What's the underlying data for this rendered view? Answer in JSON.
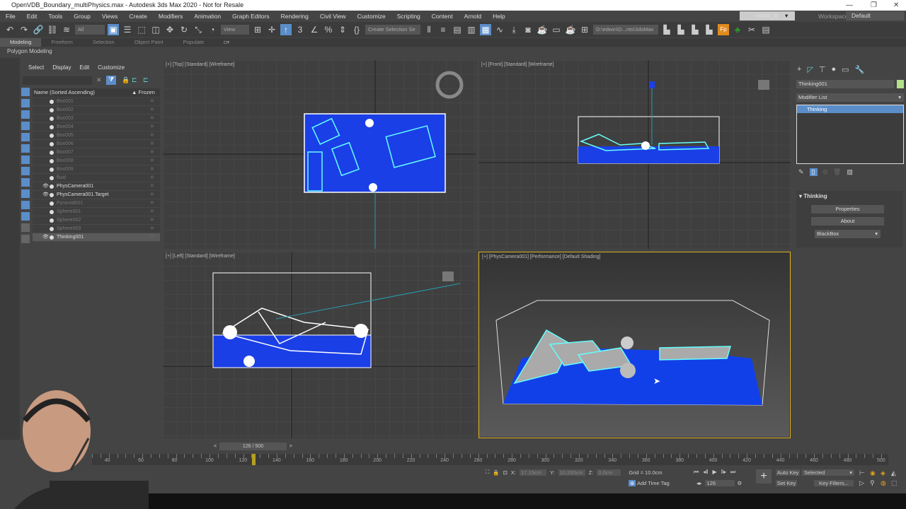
{
  "window": {
    "title": "OpenVDB_Boundary_multiPhysics.max - Autodesk 3ds Max 2020 - Not for Resale"
  },
  "menu": [
    "File",
    "Edit",
    "Tools",
    "Group",
    "Views",
    "Create",
    "Modifiers",
    "Animation",
    "Graph Editors",
    "Rendering",
    "Civil View",
    "Customize",
    "Scripting",
    "Content",
    "Arnold",
    "Help"
  ],
  "user": {
    "name": "edwin_b",
    "workspaces_label": "Workspaces:",
    "workspace": "Default"
  },
  "toolbar": {
    "filter": "All",
    "ref_coord": "View",
    "selection_set": "Create Selection Se",
    "project_path": "D:\\edwin\\D...nts\\3dsMax"
  },
  "ribbon": {
    "tabs": [
      "Modeling",
      "Freeform",
      "Selection",
      "Object Paint",
      "Populate"
    ],
    "active": "Modeling",
    "sub": "Polygon Modeling"
  },
  "explorer": {
    "menu": [
      "Select",
      "Display",
      "Edit",
      "Customize"
    ],
    "col_name": "Name (Sorted Ascending)",
    "col_frozen": "Frozen",
    "rows": [
      {
        "name": "Box001",
        "visible": false
      },
      {
        "name": "Box002",
        "visible": false
      },
      {
        "name": "Box003",
        "visible": false
      },
      {
        "name": "Box004",
        "visible": false
      },
      {
        "name": "Box005",
        "visible": false
      },
      {
        "name": "Box006",
        "visible": false
      },
      {
        "name": "Box007",
        "visible": false
      },
      {
        "name": "Box008",
        "visible": false
      },
      {
        "name": "Box009",
        "visible": false
      },
      {
        "name": "fluid",
        "visible": false
      },
      {
        "name": "PhysCamera001",
        "visible": true
      },
      {
        "name": "PhysCamera001.Target",
        "visible": true
      },
      {
        "name": "Pyramid001",
        "visible": false
      },
      {
        "name": "Sphere001",
        "visible": false
      },
      {
        "name": "Sphere002",
        "visible": false
      },
      {
        "name": "Sphere003",
        "visible": false
      },
      {
        "name": "Thinking001",
        "visible": true,
        "selected": true
      }
    ]
  },
  "viewports": {
    "top": "[+] [Top] [Standard] [Wireframe]",
    "front": "[+] [Front] [Standard] [Wireframe]",
    "left": "[+] [Left] [Standard] [Wireframe]",
    "camera": "[+] [PhysCamera001] [Performance] [Default Shading]"
  },
  "command_panel": {
    "object_name": "Thinking001",
    "object_color": "#b5e08a",
    "modifier_list": "Modifier List",
    "stack": [
      "Thinking"
    ],
    "rollout_title": "Thinking",
    "properties": "Properties",
    "about": "About",
    "blackbox": "BlackBox"
  },
  "timeline": {
    "frame_label": "126 / 500",
    "current_frame": 126,
    "total_frames": 500,
    "ticks": [
      40,
      60,
      80,
      100,
      120,
      140,
      160,
      180,
      200,
      220,
      240,
      260,
      280,
      300,
      320,
      340,
      360,
      380,
      400,
      420,
      440,
      460,
      480,
      500
    ]
  },
  "status": {
    "x_label": "X:",
    "x": "17.15cm",
    "y_label": "Y:",
    "y": "10.295cm",
    "z_label": "Z:",
    "z": "0.0cm",
    "grid": "Grid = 10.0cm",
    "add_time_tag": "Add Time Tag",
    "frame": "126",
    "auto_key": "Auto Key",
    "set_key": "Set Key",
    "key_mode": "Selected",
    "key_filters": "Key Filters..."
  }
}
